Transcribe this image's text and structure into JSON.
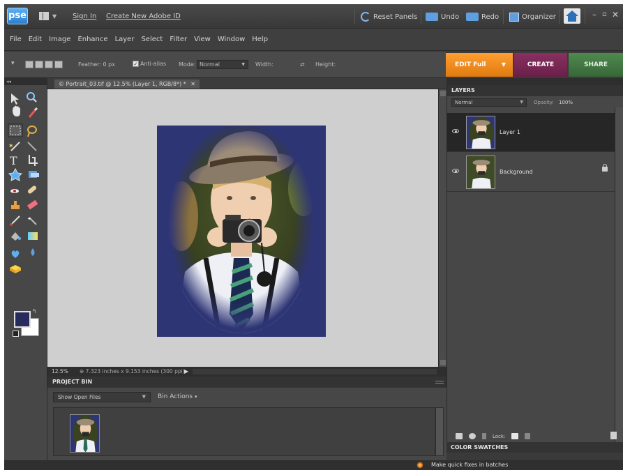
{
  "titlebar": {
    "logo": "pse",
    "sign_in": "Sign In",
    "create_id": "Create New Adobe ID",
    "reset_panels": "Reset Panels",
    "undo": "Undo",
    "redo": "Redo",
    "organizer": "Organizer",
    "icons": [
      "workspace-icon",
      "reset-icon",
      "undo-icon",
      "redo-icon",
      "organizer-icon",
      "home-icon"
    ],
    "window_controls": [
      "–",
      "▫",
      "✕"
    ]
  },
  "menu": [
    "File",
    "Edit",
    "Image",
    "Enhance",
    "Layer",
    "Select",
    "Filter",
    "View",
    "Window",
    "Help"
  ],
  "options": {
    "feather": "Feather: 0 px",
    "antialias": "Anti-alias",
    "mode_label": "Mode:",
    "mode_value": "Normal",
    "width_label": "Width:",
    "height_label": "Height:"
  },
  "mode_tabs": {
    "edit": "EDIT Full",
    "create": "CREATE",
    "share": "SHARE",
    "colors": {
      "edit": "#f08c1e",
      "create": "#7a2856",
      "share": "#447a44"
    }
  },
  "document": {
    "tab_title": "© Portrait_03.tif @ 12.5% (Layer 1, RGB/8*) *",
    "close": "✕",
    "zoom": "12.5%",
    "dimensions": "⊕ 7.323 inches x 9.153 inches (300 ppi)"
  },
  "project_bin": {
    "title": "PROJECT BIN",
    "show_filter": "Show Open Files",
    "bin_actions": "Bin Actions"
  },
  "layers": {
    "title": "LAYERS",
    "blend_mode": "Normal",
    "opacity_label": "Opacity:",
    "opacity_value": "100%",
    "items": [
      {
        "name": "Layer 1",
        "selected": true
      },
      {
        "name": "Background",
        "locked": true
      }
    ],
    "lock_label": "Lock:"
  },
  "color_swatches": {
    "title": "COLOR SWATCHES"
  },
  "status": {
    "message": "Make quick fixes in batches"
  },
  "colors": {
    "foreground": "#262a5c",
    "background": "#ffffff",
    "photo_bg": "#2e3575"
  }
}
